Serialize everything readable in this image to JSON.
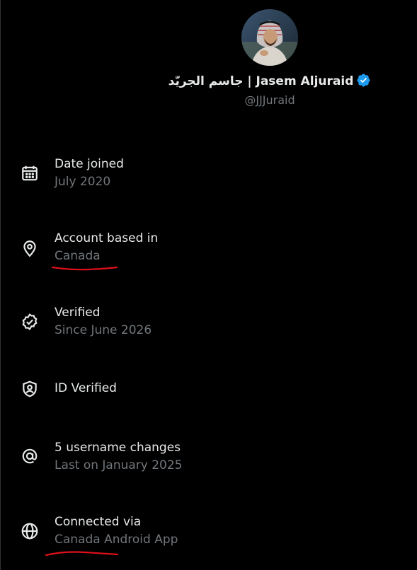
{
  "profile": {
    "name": "جاسم الجريّد | Jasem Aljuraid",
    "handle": "@JJJuraid",
    "verified_color": "#1d9bf0"
  },
  "about": {
    "items": [
      {
        "icon": "calendar-icon",
        "label": "Date joined",
        "value": "July 2020"
      },
      {
        "icon": "location-pin-icon",
        "label": "Account based in",
        "value": "Canada"
      },
      {
        "icon": "verified-badge-icon",
        "label": "Verified",
        "value": "Since June 2026"
      },
      {
        "icon": "id-shield-icon",
        "label": "ID Verified"
      },
      {
        "icon": "at-sign-icon",
        "label": "5 username changes",
        "value": "Last on January 2025"
      },
      {
        "icon": "globe-icon",
        "label": "Connected via",
        "value": "Canada Android App"
      }
    ]
  },
  "colors": {
    "background": "#000000",
    "primary_text": "#e7e9ea",
    "secondary_text": "#71767b",
    "annotation": "#e0101a"
  }
}
